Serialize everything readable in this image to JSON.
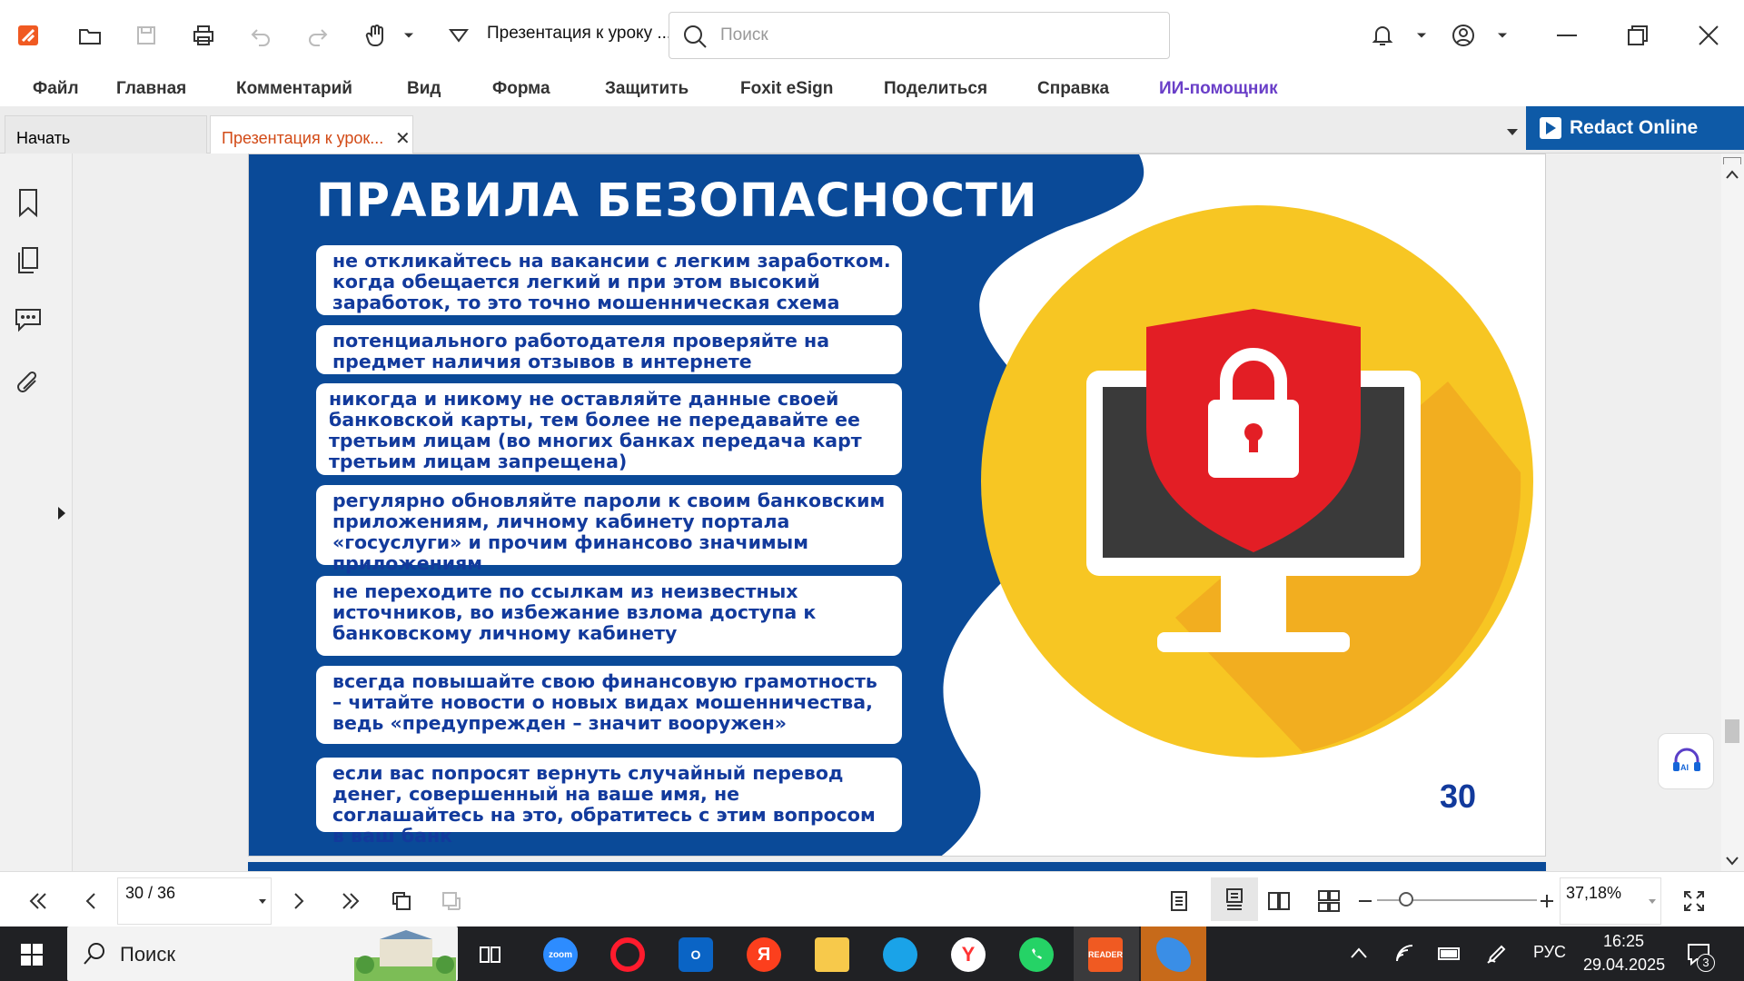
{
  "window": {
    "document_title": "Презентация к уроку ...",
    "search_placeholder": "Поиск"
  },
  "menu": [
    "Файл",
    "Главная",
    "Комментарий",
    "Вид",
    "Форма",
    "Защитить",
    "Foxit eSign",
    "Поделиться",
    "Справка",
    "ИИ-помощник"
  ],
  "tabs": [
    {
      "label": "Начать",
      "active": false
    },
    {
      "label": "Презентация к урок...",
      "active": true
    }
  ],
  "redact_label": "Redact Online",
  "slide": {
    "title": "ПРАВИЛА БЕЗОПАСНОСТИ",
    "rules": [
      "не откликайтесь на вакансии с легким заработком. когда обещается легкий и при этом высокий заработок, то это точно мошенническая схема",
      "потенциального работодателя проверяйте на предмет наличия отзывов в интернете",
      "никогда и никому не оставляйте данные своей банковской карты, тем более не передавайте ее третьим лицам (во многих банках передача карт третьим лицам запрещена)",
      "регулярно обновляйте пароли к своим банковским приложениям, личному кабинету портала «госуслуги» и прочим финансово значимым приложениям",
      "не переходите по ссылкам из неизвестных источников, во избежание взлома доступа к банковскому личному кабинету",
      "всегда повышайте свою финансовую грамотность – читайте новости о новых видах мошенничества, ведь «предупрежден – значит вооружен»",
      "если вас попросят вернуть случайный перевод денег, совершенный на ваше имя, не соглашайтесь на это, обратитесь с этим вопросом в ваш банк"
    ],
    "page_number": "30",
    "colors": {
      "blue": "#0a4a98",
      "text_blue": "#123a9c",
      "yellow": "#f7c623",
      "red": "#e31e25"
    }
  },
  "navigation": {
    "page_value": "30 / 36",
    "zoom_value": "37,18%",
    "zoom_level_percent": 37.18
  },
  "taskbar": {
    "search_label": "Поиск",
    "language": "РУС",
    "time": "16:25",
    "date": "29.04.2025",
    "notification_count": "3",
    "apps": [
      "task-view-icon",
      "zoom-icon",
      "opera-icon",
      "outlook-icon",
      "yandex-icon",
      "explorer-icon",
      "edge-icon",
      "yandex-browser-icon",
      "whatsapp-icon",
      "foxit-reader-icon",
      "app-icon"
    ]
  }
}
